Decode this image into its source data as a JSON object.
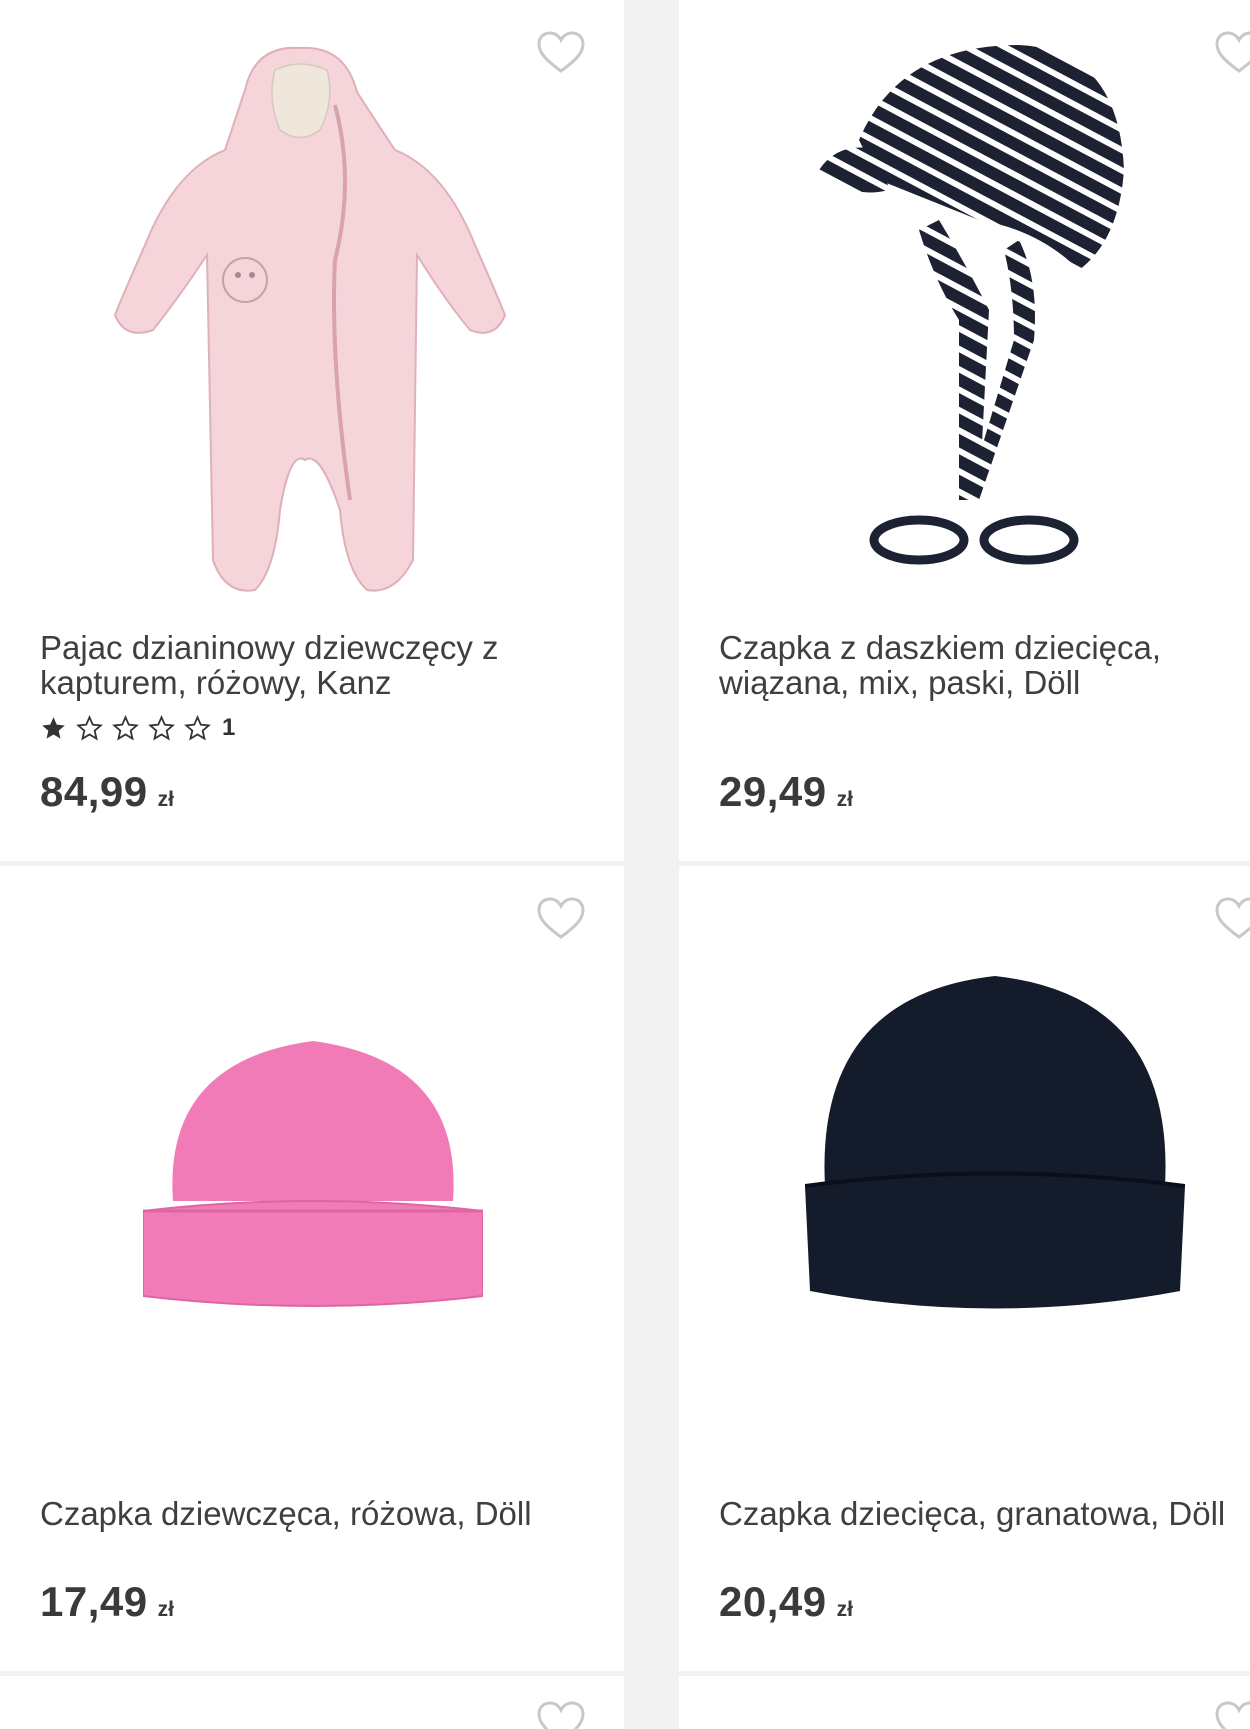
{
  "products": [
    {
      "title": "Pajac dzianinowy dziewczęcy z kapturem, różowy, Kanz",
      "rating_count": "1",
      "price": "84,99",
      "currency": "zł",
      "image": "pink-snowsuit"
    },
    {
      "title": "Czapka z daszkiem dziecięca, wiązana, mix, paski, Döll",
      "price": "29,49",
      "currency": "zł",
      "image": "striped-cap"
    },
    {
      "title": "Czapka dziewczęca, różowa, Döll",
      "price": "17,49",
      "currency": "zł",
      "image": "pink-beanie"
    },
    {
      "title": "Czapka dziecięca, granatowa, Döll",
      "price": "20,49",
      "currency": "zł",
      "image": "navy-beanie"
    }
  ],
  "icons": {
    "favorite": "heart-outline-icon",
    "rating_filled": "star-filled-icon",
    "rating_empty": "star-outline-icon"
  },
  "colors": {
    "background": "#f2f2f2",
    "card": "#ffffff",
    "text": "#3f3f3f",
    "heart": "#c8c8c8"
  }
}
